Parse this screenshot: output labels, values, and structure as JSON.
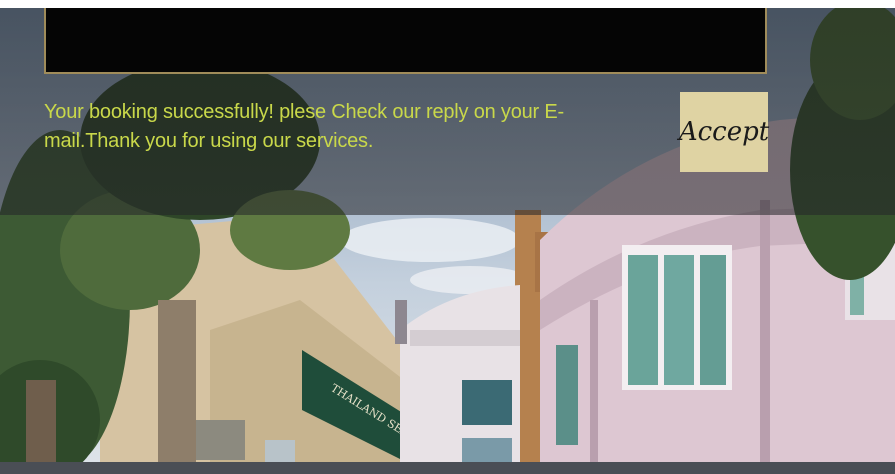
{
  "banner": {
    "message": "Your booking successfully! plese Check our reply on your E-mail.Thank you for using our services.",
    "accept_label": "Accept"
  },
  "background": {
    "sign_text": "THAILAND SEASIA"
  },
  "colors": {
    "message_text": "#c9d84a",
    "accept_bg": "#dfd3a3",
    "black_box_border": "#a08c5a",
    "bottom_bar": "#4a4e55"
  }
}
